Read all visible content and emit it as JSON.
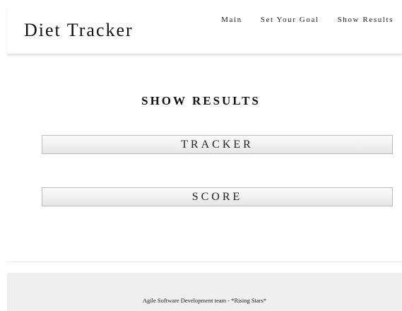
{
  "header": {
    "brand": "Diet Tracker",
    "nav": [
      {
        "label": "Main"
      },
      {
        "label": "Set Your Goal"
      },
      {
        "label": "Show Results"
      }
    ]
  },
  "main": {
    "title": "SHOW RESULTS",
    "buttons": [
      {
        "label": "TRACKER"
      },
      {
        "label": "SCORE"
      }
    ]
  },
  "footer": {
    "text": "Agile Software Development team - *Rising Stars*"
  }
}
